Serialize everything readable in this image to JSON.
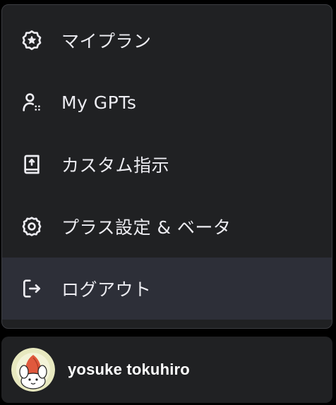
{
  "menu": {
    "items": [
      {
        "label": "マイプラン",
        "icon": "plan-star-icon"
      },
      {
        "label": "My GPTs",
        "icon": "gpts-user-icon"
      },
      {
        "label": "カスタム指示",
        "icon": "custom-instructions-book-icon"
      },
      {
        "label": "プラス設定 & ベータ",
        "icon": "settings-gear-icon"
      },
      {
        "label": "ログアウト",
        "icon": "logout-icon"
      }
    ],
    "active_item": "ログアウト"
  },
  "user": {
    "name": "yosuke tokuhiro",
    "avatar": "avatar-illustration"
  },
  "colors": {
    "menu_bg": "#202123",
    "hover_bg": "#2d2f38",
    "text": "#ececf1",
    "page_bg": "#000000"
  }
}
